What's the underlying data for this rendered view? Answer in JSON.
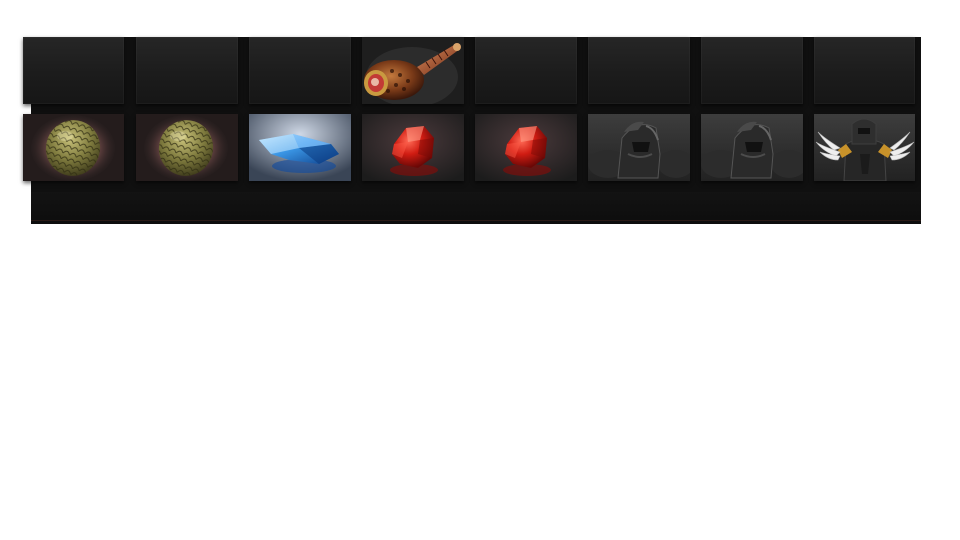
{
  "inventory": {
    "top_row": [
      {
        "item": "empty"
      },
      {
        "item": "empty"
      },
      {
        "item": "empty"
      },
      {
        "item": "meat-club-icon"
      },
      {
        "item": "empty"
      },
      {
        "item": "empty"
      },
      {
        "item": "empty"
      },
      {
        "item": "empty"
      }
    ],
    "bottom_row": [
      {
        "item": "dragon-egg-icon"
      },
      {
        "item": "dragon-egg-icon"
      },
      {
        "item": "blue-crystal-icon"
      },
      {
        "item": "red-gem-icon"
      },
      {
        "item": "red-gem-icon"
      },
      {
        "item": "dark-helmet-icon"
      },
      {
        "item": "dark-helmet-icon"
      },
      {
        "item": "winged-armor-icon"
      }
    ]
  },
  "colors": {
    "panel_bg": "#101010",
    "slot_bg": "#1e1e1e",
    "egg": "#8c8a4a",
    "crystal": "#3a8fe0",
    "gem": "#d0221a",
    "armor": "#3a3a3a",
    "wing": "#e8e8e8",
    "trim": "#c8922a"
  }
}
